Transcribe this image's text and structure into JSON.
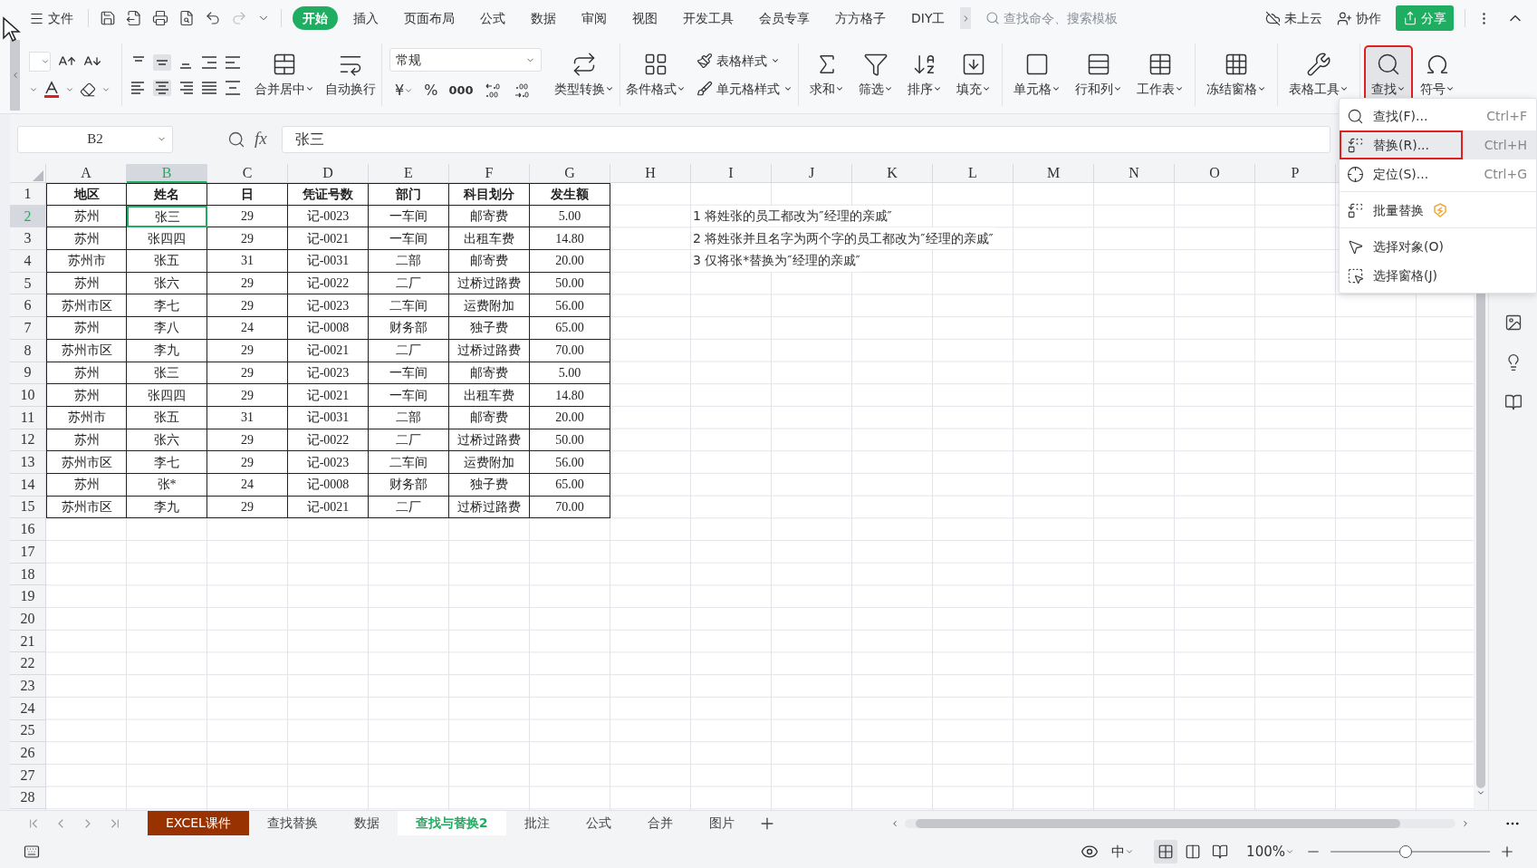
{
  "toolbar": {
    "file": "文件",
    "tabs": [
      {
        "label": "开始",
        "selected": true
      },
      {
        "label": "插入",
        "selected": false
      },
      {
        "label": "页面布局",
        "selected": false
      },
      {
        "label": "公式",
        "selected": false
      },
      {
        "label": "数据",
        "selected": false
      },
      {
        "label": "审阅",
        "selected": false
      },
      {
        "label": "视图",
        "selected": false
      },
      {
        "label": "开发工具",
        "selected": false
      },
      {
        "label": "会员专享",
        "selected": false
      },
      {
        "label": "方方格子",
        "selected": false
      },
      {
        "label": "DIY工",
        "selected": false
      }
    ],
    "search": {
      "placeholder": "查找命令、搜索模板"
    },
    "cloud": "未上云",
    "collaborate": "协作",
    "share": "分享"
  },
  "ribbon": {
    "merge": "合并居中",
    "wrap": "自动换行",
    "number_format": "常规",
    "currency": "¥",
    "percent": "%",
    "thousands": "000",
    "convert": "类型转换",
    "conditional_format": "条件格式",
    "table_style": "表格样式",
    "cell_style": "单元格样式",
    "tools": [
      {
        "label": "求和",
        "selected": false
      },
      {
        "label": "筛选",
        "selected": false
      },
      {
        "label": "排序",
        "selected": false
      },
      {
        "label": "填充",
        "selected": false
      },
      {
        "label": "单元格",
        "selected": false
      },
      {
        "label": "行和列",
        "selected": false
      },
      {
        "label": "工作表",
        "selected": false
      },
      {
        "label": "冻结窗格",
        "selected": false
      },
      {
        "label": "表格工具",
        "selected": false
      },
      {
        "label": "查找",
        "selected": true
      },
      {
        "label": "符号",
        "selected": false
      }
    ]
  },
  "formula_bar": {
    "name_box": "B2",
    "fx": "fx",
    "formula": "张三"
  },
  "sheet": {
    "columns": [
      {
        "label": "A",
        "selected": false
      },
      {
        "label": "B",
        "selected": true
      },
      {
        "label": "C",
        "selected": false
      },
      {
        "label": "D",
        "selected": false
      },
      {
        "label": "E",
        "selected": false
      },
      {
        "label": "F",
        "selected": false
      },
      {
        "label": "G",
        "selected": false
      },
      {
        "label": "H",
        "selected": false
      },
      {
        "label": "I",
        "selected": false
      },
      {
        "label": "J",
        "selected": false
      },
      {
        "label": "K",
        "selected": false
      },
      {
        "label": "L",
        "selected": false
      },
      {
        "label": "M",
        "selected": false
      },
      {
        "label": "N",
        "selected": false
      },
      {
        "label": "O",
        "selected": false
      },
      {
        "label": "P",
        "selected": false
      }
    ],
    "rows": [
      {
        "label": "1",
        "selected": false
      },
      {
        "label": "2",
        "selected": true
      },
      {
        "label": "3",
        "selected": false
      },
      {
        "label": "4",
        "selected": false
      },
      {
        "label": "5",
        "selected": false
      },
      {
        "label": "6",
        "selected": false
      },
      {
        "label": "7",
        "selected": false
      },
      {
        "label": "8",
        "selected": false
      },
      {
        "label": "9",
        "selected": false
      },
      {
        "label": "10",
        "selected": false
      },
      {
        "label": "11",
        "selected": false
      },
      {
        "label": "12",
        "selected": false
      },
      {
        "label": "13",
        "selected": false
      },
      {
        "label": "14",
        "selected": false
      },
      {
        "label": "15",
        "selected": false
      },
      {
        "label": "16",
        "selected": false
      },
      {
        "label": "17",
        "selected": false
      },
      {
        "label": "18",
        "selected": false
      },
      {
        "label": "19",
        "selected": false
      },
      {
        "label": "20",
        "selected": false
      },
      {
        "label": "21",
        "selected": false
      },
      {
        "label": "22",
        "selected": false
      },
      {
        "label": "23",
        "selected": false
      },
      {
        "label": "24",
        "selected": false
      },
      {
        "label": "25",
        "selected": false
      },
      {
        "label": "26",
        "selected": false
      },
      {
        "label": "27",
        "selected": false
      },
      {
        "label": "28",
        "selected": false
      }
    ],
    "table": {
      "header": [
        "地区",
        "姓名",
        "日",
        "凭证号数",
        "部门",
        "科目划分",
        "发生额"
      ],
      "body": [
        [
          "苏州",
          "张三",
          "29",
          "记-0023",
          "一车间",
          "邮寄费",
          "5.00"
        ],
        [
          "苏州",
          "张四四",
          "29",
          "记-0021",
          "一车间",
          "出租车费",
          "14.80"
        ],
        [
          "苏州市",
          "张五",
          "31",
          "记-0031",
          "二部",
          "邮寄费",
          "20.00"
        ],
        [
          "苏州",
          "张六",
          "29",
          "记-0022",
          "二厂",
          "过桥过路费",
          "50.00"
        ],
        [
          "苏州市区",
          "李七",
          "29",
          "记-0023",
          "二车间",
          "运费附加",
          "56.00"
        ],
        [
          "苏州",
          "李八",
          "24",
          "记-0008",
          "财务部",
          "独子费",
          "65.00"
        ],
        [
          "苏州市区",
          "李九",
          "29",
          "记-0021",
          "二厂",
          "过桥过路费",
          "70.00"
        ],
        [
          "苏州",
          "张三",
          "29",
          "记-0023",
          "一车间",
          "邮寄费",
          "5.00"
        ],
        [
          "苏州",
          "张四四",
          "29",
          "记-0021",
          "一车间",
          "出租车费",
          "14.80"
        ],
        [
          "苏州市",
          "张五",
          "31",
          "记-0031",
          "二部",
          "邮寄费",
          "20.00"
        ],
        [
          "苏州",
          "张六",
          "29",
          "记-0022",
          "二厂",
          "过桥过路费",
          "50.00"
        ],
        [
          "苏州市区",
          "李七",
          "29",
          "记-0023",
          "二车间",
          "运费附加",
          "56.00"
        ],
        [
          "苏州",
          "张*",
          "24",
          "记-0008",
          "财务部",
          "独子费",
          "65.00"
        ],
        [
          "苏州市区",
          "李九",
          "29",
          "记-0021",
          "二厂",
          "过桥过路费",
          "70.00"
        ]
      ]
    },
    "notes": [
      "1  将姓张的员工都改为″经理的亲戚″",
      "2  将姓张并且名字为两个字的员工都改为″经理的亲戚″",
      "3  仅将张*替换为″经理的亲戚″"
    ]
  },
  "find_menu": {
    "groups": [
      [
        {
          "label": "查找(F)...",
          "shortcut": "Ctrl+F",
          "selected": false,
          "badge": false
        },
        {
          "label": "替换(R)...",
          "shortcut": "Ctrl+H",
          "selected": true,
          "badge": false
        },
        {
          "label": "定位(S)...",
          "shortcut": "Ctrl+G",
          "selected": false,
          "badge": false
        }
      ],
      [
        {
          "label": "批量替换",
          "selected": false,
          "badge": true
        }
      ],
      [
        {
          "label": "选择对象(O)",
          "selected": false,
          "badge": false
        },
        {
          "label": "选择窗格(J)",
          "selected": false,
          "badge": false
        }
      ]
    ]
  },
  "sheet_tabs": [
    {
      "label": "EXCEL课件",
      "selected": false,
      "color": "#983200"
    },
    {
      "label": "查找替换",
      "selected": false
    },
    {
      "label": "数据",
      "selected": false
    },
    {
      "label": "查找与替换2",
      "selected": true
    },
    {
      "label": "批注",
      "selected": false
    },
    {
      "label": "公式",
      "selected": false
    },
    {
      "label": "合并",
      "selected": false
    },
    {
      "label": "图片",
      "selected": false
    }
  ],
  "status_bar": {
    "input_mode": "中",
    "zoom": "100%",
    "zoom_slider": {
      "level": 0.47
    }
  }
}
